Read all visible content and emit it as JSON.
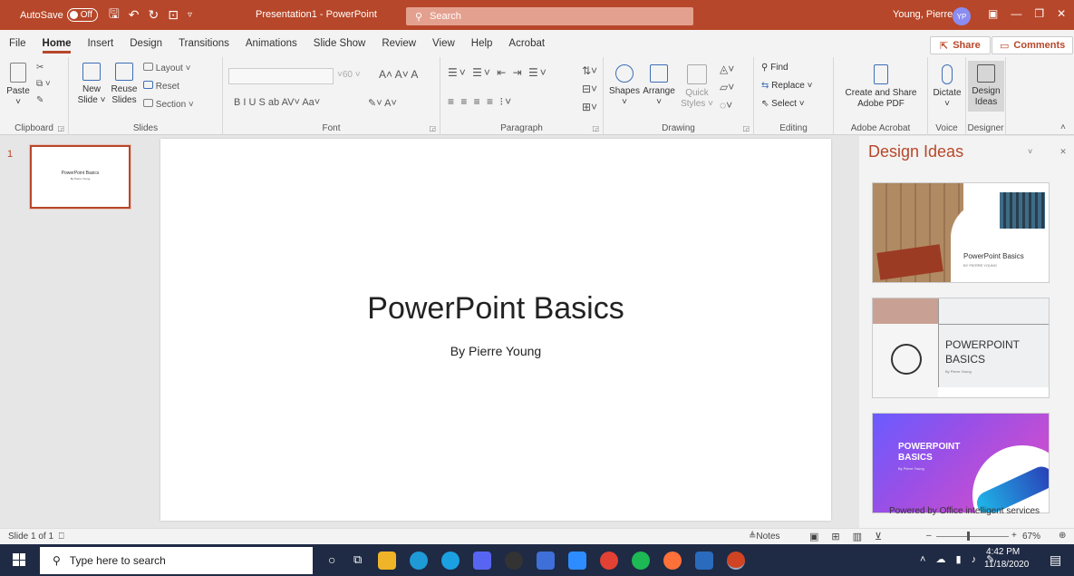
{
  "title_bar": {
    "autosave_label": "AutoSave",
    "autosave_state": "Off",
    "document_title": "Presentation1 - PowerPoint",
    "search_label": "Search",
    "user_name": "Young, Pierre",
    "user_initials": "YP"
  },
  "tabs": [
    "File",
    "Home",
    "Insert",
    "Design",
    "Transitions",
    "Animations",
    "Slide Show",
    "Review",
    "View",
    "Help",
    "Acrobat"
  ],
  "active_tab": "Home",
  "share_label": "Share",
  "comments_label": "Comments",
  "ribbon": {
    "clipboard": {
      "paste": "Paste",
      "label": "Clipboard"
    },
    "slides": {
      "new_slide": "New",
      "new_slide2": "Slide ˅",
      "reuse": "Reuse",
      "reuse2": "Slides",
      "layout": "Layout ˅",
      "reset": "Reset",
      "section": "Section ˅",
      "label": "Slides"
    },
    "font": {
      "size": "60",
      "label": "Font",
      "format_row": "B  I  U  S  ab  AV˅  Aa˅"
    },
    "paragraph": {
      "label": "Paragraph"
    },
    "drawing": {
      "shapes": "Shapes",
      "arrange": "Arrange",
      "quick": "Quick",
      "quick2": "Styles ˅",
      "label": "Drawing"
    },
    "editing": {
      "find": "Find",
      "replace": "Replace ˅",
      "select": "Select ˅",
      "label": "Editing"
    },
    "adobe": {
      "create": "Create and Share",
      "create2": "Adobe PDF",
      "label": "Adobe Acrobat"
    },
    "voice": {
      "dictate": "Dictate",
      "label": "Voice"
    },
    "designer": {
      "design": "Design",
      "design2": "Ideas",
      "label": "Designer"
    }
  },
  "thumbnail": {
    "number": "1",
    "title": "PowerPoint Basics",
    "subtitle": "By Pierre Young"
  },
  "slide": {
    "title": "PowerPoint Basics",
    "subtitle": "By Pierre Young"
  },
  "design_ideas": {
    "header": "Design Ideas",
    "idea1_title": "PowerPoint Basics",
    "idea1_sub": "BY PIERRE YOUNG",
    "idea2_title_line1": "POWERPOINT",
    "idea2_title_line2": "BASICS",
    "idea2_sub": "By Pierre Young",
    "idea3_title_line1": "POWERPOINT",
    "idea3_title_line2": "BASICS",
    "idea3_sub": "By Pierre Young",
    "powered": "Powered by Office intelligent services"
  },
  "status": {
    "slide_count": "Slide 1 of 1",
    "notes": "Notes",
    "zoom": "67%",
    "zoom_fraction": 0.67
  },
  "taskbar": {
    "search_placeholder": "Type here to search",
    "time": "4:42 PM",
    "date": "11/18/2020"
  },
  "colors": {
    "accent": "#b7472a",
    "taskbar": "#1f2a44",
    "ribbon": "#f3f3f3"
  }
}
